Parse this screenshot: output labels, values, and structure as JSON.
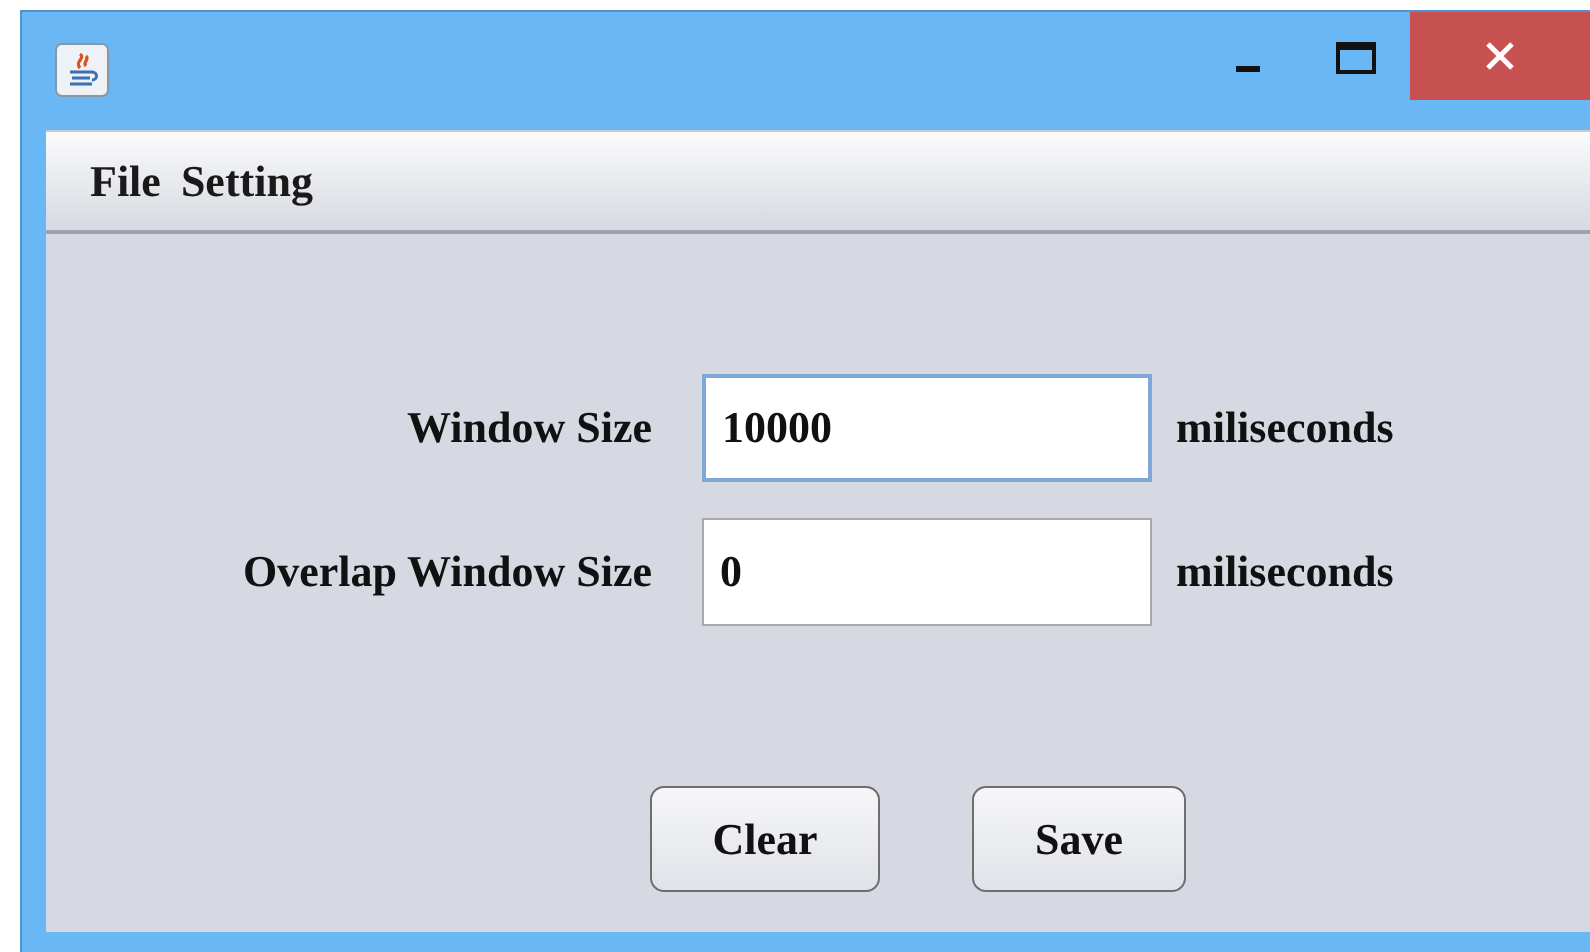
{
  "menu": [
    {
      "label": "File"
    },
    {
      "label": "Setting"
    }
  ],
  "fields": [
    {
      "label": "Window Size",
      "value": "10000",
      "unit": "miliseconds",
      "focused": true
    },
    {
      "label": "Overlap Window Size",
      "value": "0",
      "unit": "miliseconds",
      "focused": false
    }
  ],
  "buttons": [
    "Clear",
    "Save"
  ]
}
